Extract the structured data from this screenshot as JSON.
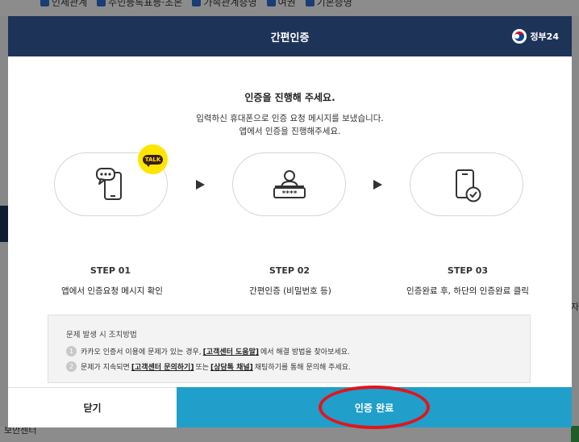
{
  "background": {
    "checkboxes": [
      "인세관계",
      "주민등록표등·초본",
      "가족관계증명",
      "여권",
      "기본증명"
    ],
    "bottom_left": "보안센터",
    "right_fragment": "자"
  },
  "modal": {
    "title": "간편인증",
    "brand": "정부24",
    "heading": "인증을 진행해 주세요.",
    "desc_line1": "입력하신 휴대폰으로 인증 요청 메시지를 보냈습니다.",
    "desc_line2": "앱에서 인증을 진행해주세요.",
    "badge": "TALK",
    "steps": [
      {
        "label": "STEP 01",
        "desc": "앱에서 인증요청 메시지 확인",
        "icon": "phone-message-icon"
      },
      {
        "label": "STEP 02",
        "desc": "간편인증 (비밀번호 등)",
        "icon": "password-user-icon"
      },
      {
        "label": "STEP 03",
        "desc": "인증완료 후, 하단의 인증완료 클릭",
        "icon": "phone-check-icon"
      }
    ],
    "help": {
      "title": "문제 발생 시 조치방법",
      "item1": {
        "num": "1",
        "pre": "카카오 인증서 이용에 문제가 있는 경우,",
        "link": "[고객센터 도움말]",
        "post": "에서 해결 방법을 찾아보세요."
      },
      "item2": {
        "num": "2",
        "pre": "문제가 지속되면",
        "link1": "[고객센터 문의하기]",
        "mid": "또는",
        "link2": "[상담톡 채널]",
        "post": "채팅하기를 통해 문의해 주세요."
      }
    },
    "buttons": {
      "close": "닫기",
      "done": "인증 완료"
    }
  },
  "colors": {
    "header": "#1e3358",
    "primary": "#1f9fc9",
    "highlight": "#e4141b",
    "kakao": "#fde500"
  }
}
